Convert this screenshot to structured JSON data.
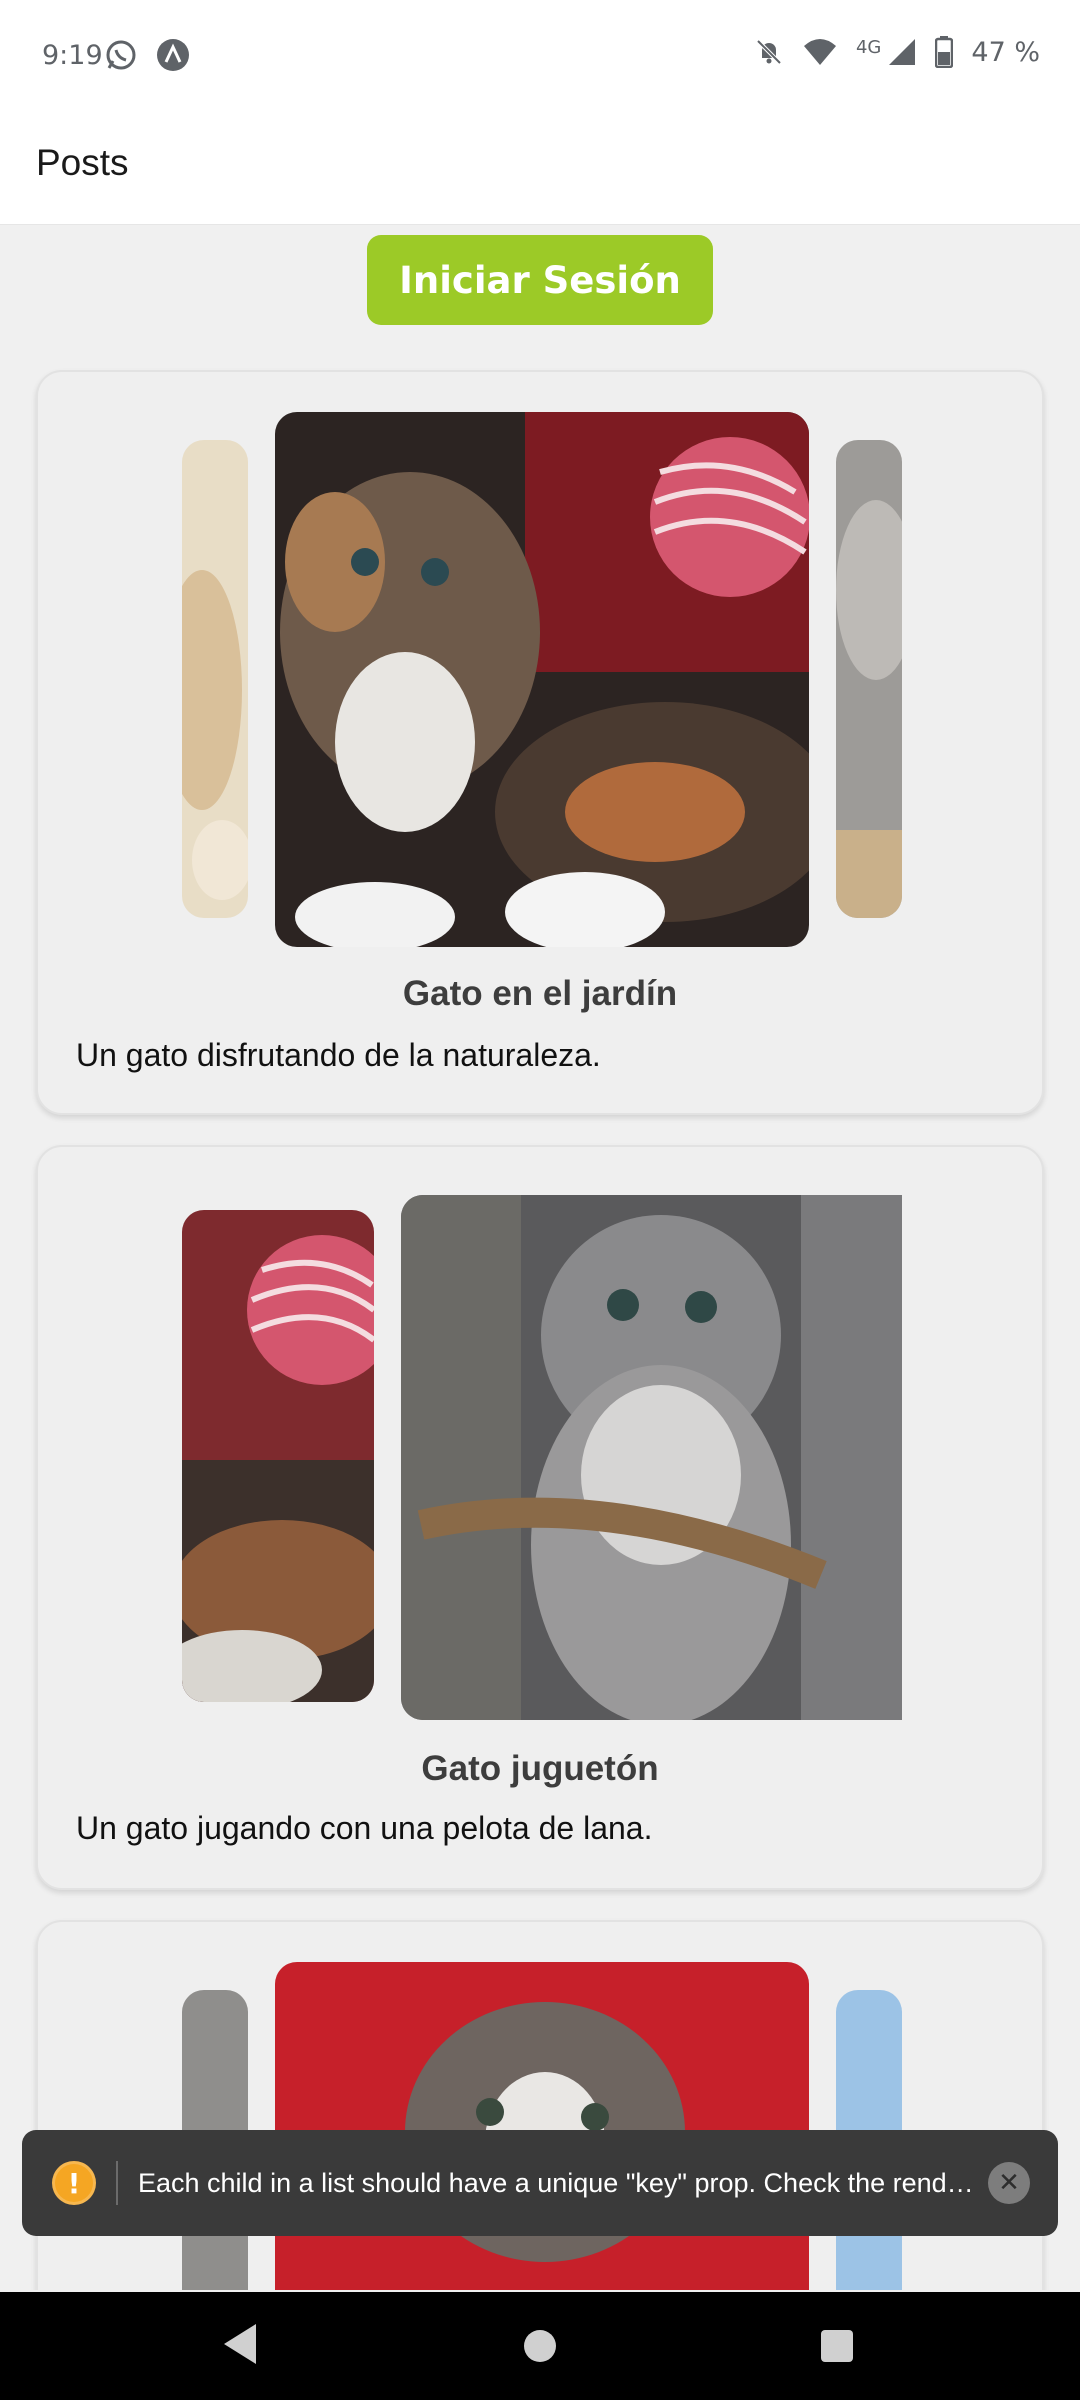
{
  "status_bar": {
    "time": "9:19",
    "left_icons": [
      "whatsapp-icon",
      "app-icon"
    ],
    "network": "4G",
    "battery": "47 %"
  },
  "header": {
    "title": "Posts"
  },
  "login_button": {
    "label": "Iniciar Sesión",
    "color": "#9cca27"
  },
  "posts": [
    {
      "title": "Gato en el jardín",
      "description": "Un gato disfrutando de la naturaleza."
    },
    {
      "title": "Gato juguetón",
      "description": "Un gato jugando con una pelota de lana."
    },
    {
      "title": "",
      "description": ""
    }
  ],
  "toast": {
    "message": "Each child in a list should have a unique \"key\" prop.  Check the rend…"
  }
}
